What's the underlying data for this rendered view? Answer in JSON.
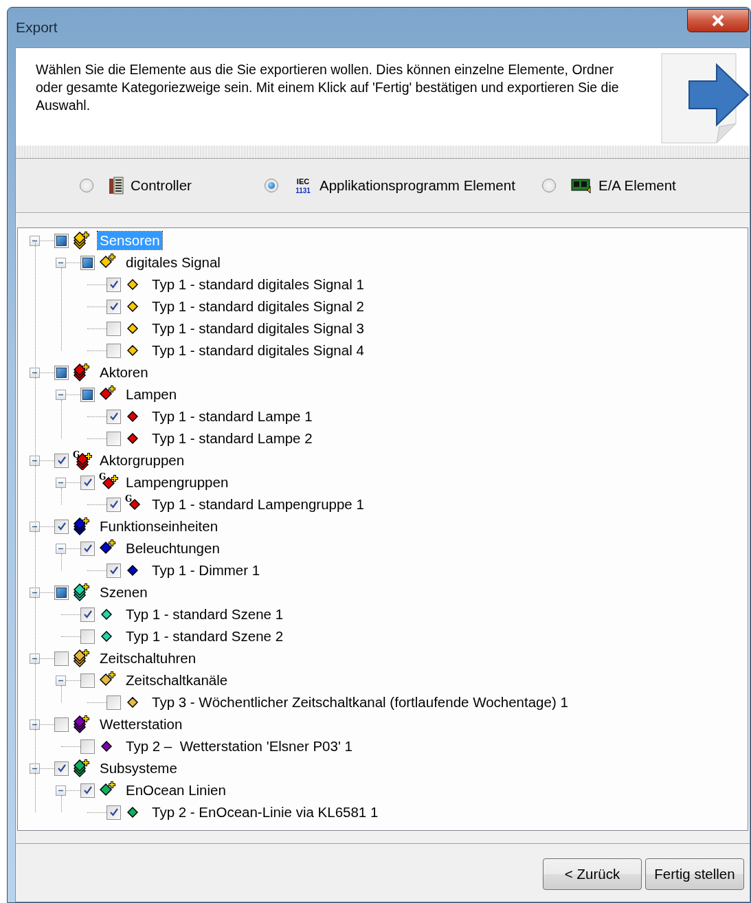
{
  "window": {
    "title": "Export"
  },
  "intro": {
    "text": "Wählen Sie die Elemente aus die Sie exportieren wollen. Dies können einzelne Elemente, Ordner oder gesamte Kategoriezweige sein. Mit einem Klick auf 'Fertig' bestätigen und exportieren Sie die Auswahl."
  },
  "source_options": [
    {
      "label": "Controller",
      "kind": "controller",
      "selected": false
    },
    {
      "label": "Applikationsprogramm Element",
      "kind": "iec",
      "icon_lines": [
        "IEC",
        "1131"
      ],
      "selected": true
    },
    {
      "label": "E/A Element",
      "kind": "io",
      "selected": false
    }
  ],
  "tree": [
    {
      "label": "Sensoren",
      "kind": "category",
      "color": "#f8c800",
      "checked": false,
      "partial": true,
      "selected": true,
      "expanded": true,
      "children": [
        {
          "label": "digitales Signal",
          "kind": "folder",
          "color": "#f8c800",
          "checked": false,
          "partial": true,
          "selected": false,
          "expanded": true,
          "children": [
            {
              "label": "Typ 1 - standard digitales Signal 1",
              "kind": "item",
              "color": "#f8c800",
              "checked": true,
              "partial": false,
              "selected": false
            },
            {
              "label": "Typ 1 - standard digitales Signal 2",
              "kind": "item",
              "color": "#f8c800",
              "checked": true,
              "partial": false,
              "selected": false
            },
            {
              "label": "Typ 1 - standard digitales Signal 3",
              "kind": "item",
              "color": "#f8c800",
              "checked": false,
              "partial": false,
              "selected": false
            },
            {
              "label": "Typ 1 - standard digitales Signal 4",
              "kind": "item",
              "color": "#f8c800",
              "checked": false,
              "partial": false,
              "selected": false
            }
          ]
        }
      ]
    },
    {
      "label": "Aktoren",
      "kind": "category",
      "color": "#e00000",
      "checked": false,
      "partial": true,
      "selected": false,
      "expanded": true,
      "children": [
        {
          "label": "Lampen",
          "kind": "folder",
          "color": "#e00000",
          "checked": false,
          "partial": true,
          "selected": false,
          "expanded": true,
          "children": [
            {
              "label": "Typ 1 - standard Lampe 1",
              "kind": "item",
              "color": "#e00000",
              "checked": true,
              "partial": false,
              "selected": false
            },
            {
              "label": "Typ 1 - standard Lampe 2",
              "kind": "item",
              "color": "#e00000",
              "checked": false,
              "partial": false,
              "selected": false
            }
          ]
        }
      ]
    },
    {
      "label": "Aktorgruppen",
      "kind": "category",
      "color": "#e00000",
      "badge": "G",
      "checked": true,
      "partial": false,
      "selected": false,
      "expanded": true,
      "children": [
        {
          "label": "Lampengruppen",
          "kind": "folder",
          "color": "#e00000",
          "badge": "G",
          "checked": true,
          "partial": false,
          "selected": false,
          "expanded": true,
          "children": [
            {
              "label": "Typ 1 - standard Lampengruppe 1",
              "kind": "item",
              "color": "#e00000",
              "badge": "G",
              "checked": true,
              "partial": false,
              "selected": false
            }
          ]
        }
      ]
    },
    {
      "label": "Funktionseinheiten",
      "kind": "category",
      "color": "#0008c0",
      "checked": true,
      "partial": false,
      "selected": false,
      "expanded": true,
      "children": [
        {
          "label": "Beleuchtungen",
          "kind": "folder",
          "color": "#0008c0",
          "checked": true,
          "partial": false,
          "selected": false,
          "expanded": true,
          "children": [
            {
              "label": "Typ 1 - Dimmer 1",
              "kind": "item",
              "color": "#0008c0",
              "checked": true,
              "partial": false,
              "selected": false
            }
          ]
        }
      ]
    },
    {
      "label": "Szenen",
      "kind": "category",
      "color": "#20d8a8",
      "checked": false,
      "partial": true,
      "selected": false,
      "expanded": true,
      "children": [
        {
          "label": "Typ 1 - standard Szene 1",
          "kind": "item",
          "color": "#20d8a8",
          "checked": true,
          "partial": false,
          "selected": false
        },
        {
          "label": "Typ 1 - standard Szene 2",
          "kind": "item",
          "color": "#20d8a8",
          "checked": false,
          "partial": false,
          "selected": false
        }
      ]
    },
    {
      "label": "Zeitschaltuhren",
      "kind": "category",
      "color": "#e8b840",
      "checked": false,
      "partial": false,
      "selected": false,
      "expanded": true,
      "children": [
        {
          "label": "Zeitschaltkanäle",
          "kind": "folder",
          "color": "#e8b840",
          "checked": false,
          "partial": false,
          "selected": false,
          "expanded": true,
          "children": [
            {
              "label": "Typ 3 - Wöchentlicher Zeitschaltkanal (fortlaufende Wochentage) 1",
              "kind": "item",
              "color": "#e8b840",
              "checked": false,
              "partial": false,
              "selected": false
            }
          ]
        }
      ]
    },
    {
      "label": "Wetterstation",
      "kind": "category",
      "color": "#8000b0",
      "checked": false,
      "partial": false,
      "selected": false,
      "expanded": true,
      "children": [
        {
          "label": "Typ 2 –  Wetterstation 'Elsner P03' 1",
          "kind": "item",
          "color": "#8000b0",
          "checked": false,
          "partial": false,
          "selected": false
        }
      ]
    },
    {
      "label": "Subsysteme",
      "kind": "category",
      "color": "#10b060",
      "checked": true,
      "partial": false,
      "selected": false,
      "expanded": true,
      "children": [
        {
          "label": "EnOcean Linien",
          "kind": "folder",
          "color": "#10b060",
          "checked": true,
          "partial": false,
          "selected": false,
          "expanded": true,
          "children": [
            {
              "label": "Typ 2 - EnOcean-Linie via KL6581 1",
              "kind": "item",
              "color": "#10b060",
              "checked": true,
              "partial": false,
              "selected": false
            }
          ]
        }
      ]
    }
  ],
  "buttons": [
    {
      "label": "< Zurück"
    },
    {
      "label": "Fertig stellen"
    }
  ]
}
